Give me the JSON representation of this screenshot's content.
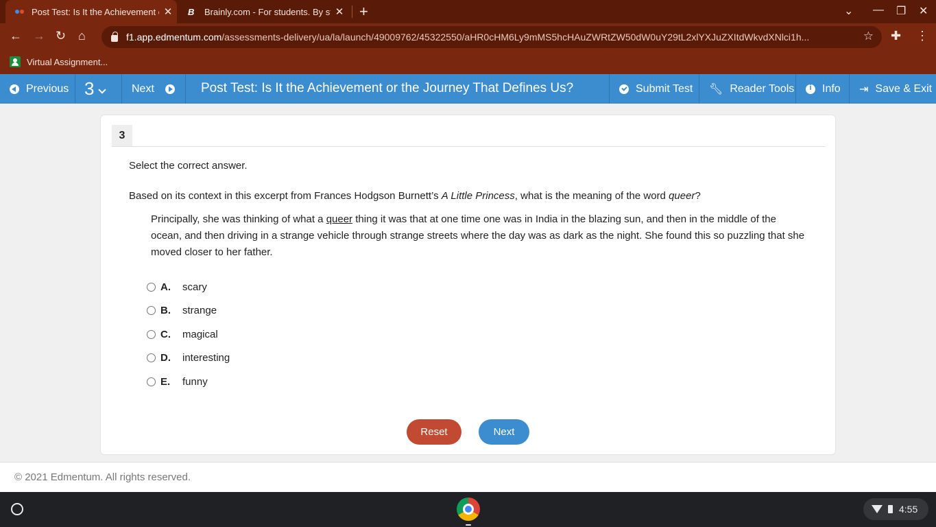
{
  "browser": {
    "tabs": [
      {
        "title": "Post Test: Is It the Achievement or the Journey That Defines Us?",
        "active": true
      },
      {
        "title": "Brainly.com - For students. By students.",
        "active": false
      }
    ],
    "url_host": "f1.app.edmentum.com",
    "url_path": "/assessments-delivery/ua/la/launch/49009762/45322550/aHR0cHM6Ly9mMS5hcHAuZWRtZW50dW0uY29tL2xlYXJuZXItdWkvdXNlci1h...",
    "bookmark": "Virtual Assignment..."
  },
  "appbar": {
    "previous": "Previous",
    "question_number": "3",
    "next": "Next",
    "title": "Post Test: Is It the Achievement or the Journey That Defines Us?",
    "submit": "Submit Test",
    "reader_tools": "Reader Tools",
    "info": "Info",
    "save_exit": "Save & Exit"
  },
  "question": {
    "number": "3",
    "instruction": "Select the correct answer.",
    "prompt_start": "Based on its context in this excerpt from Frances Hodgson Burnett’s ",
    "prompt_title": "A Little Princess",
    "prompt_mid": ", what is the meaning of the word ",
    "prompt_word": "queer",
    "prompt_end": "?",
    "passage_start": "Principally, she was thinking of what a ",
    "passage_word": "queer",
    "passage_end": " thing it was that at one time one was in India in the blazing sun, and then in the middle of the ocean, and then driving in a strange vehicle through strange streets where the day was as dark as the night. She found this so puzzling that she moved closer to her father.",
    "choices": [
      {
        "letter": "A.",
        "text": "scary"
      },
      {
        "letter": "B.",
        "text": "strange"
      },
      {
        "letter": "C.",
        "text": "magical"
      },
      {
        "letter": "D.",
        "text": "interesting"
      },
      {
        "letter": "E.",
        "text": "funny"
      }
    ],
    "reset_label": "Reset",
    "next_label": "Next"
  },
  "footer": "© 2021 Edmentum. All rights reserved.",
  "system": {
    "clock": "4:55"
  },
  "colors": {
    "accent": "#3c8dd0",
    "reset": "#c24a33",
    "browser_frame": "#7a2710"
  }
}
